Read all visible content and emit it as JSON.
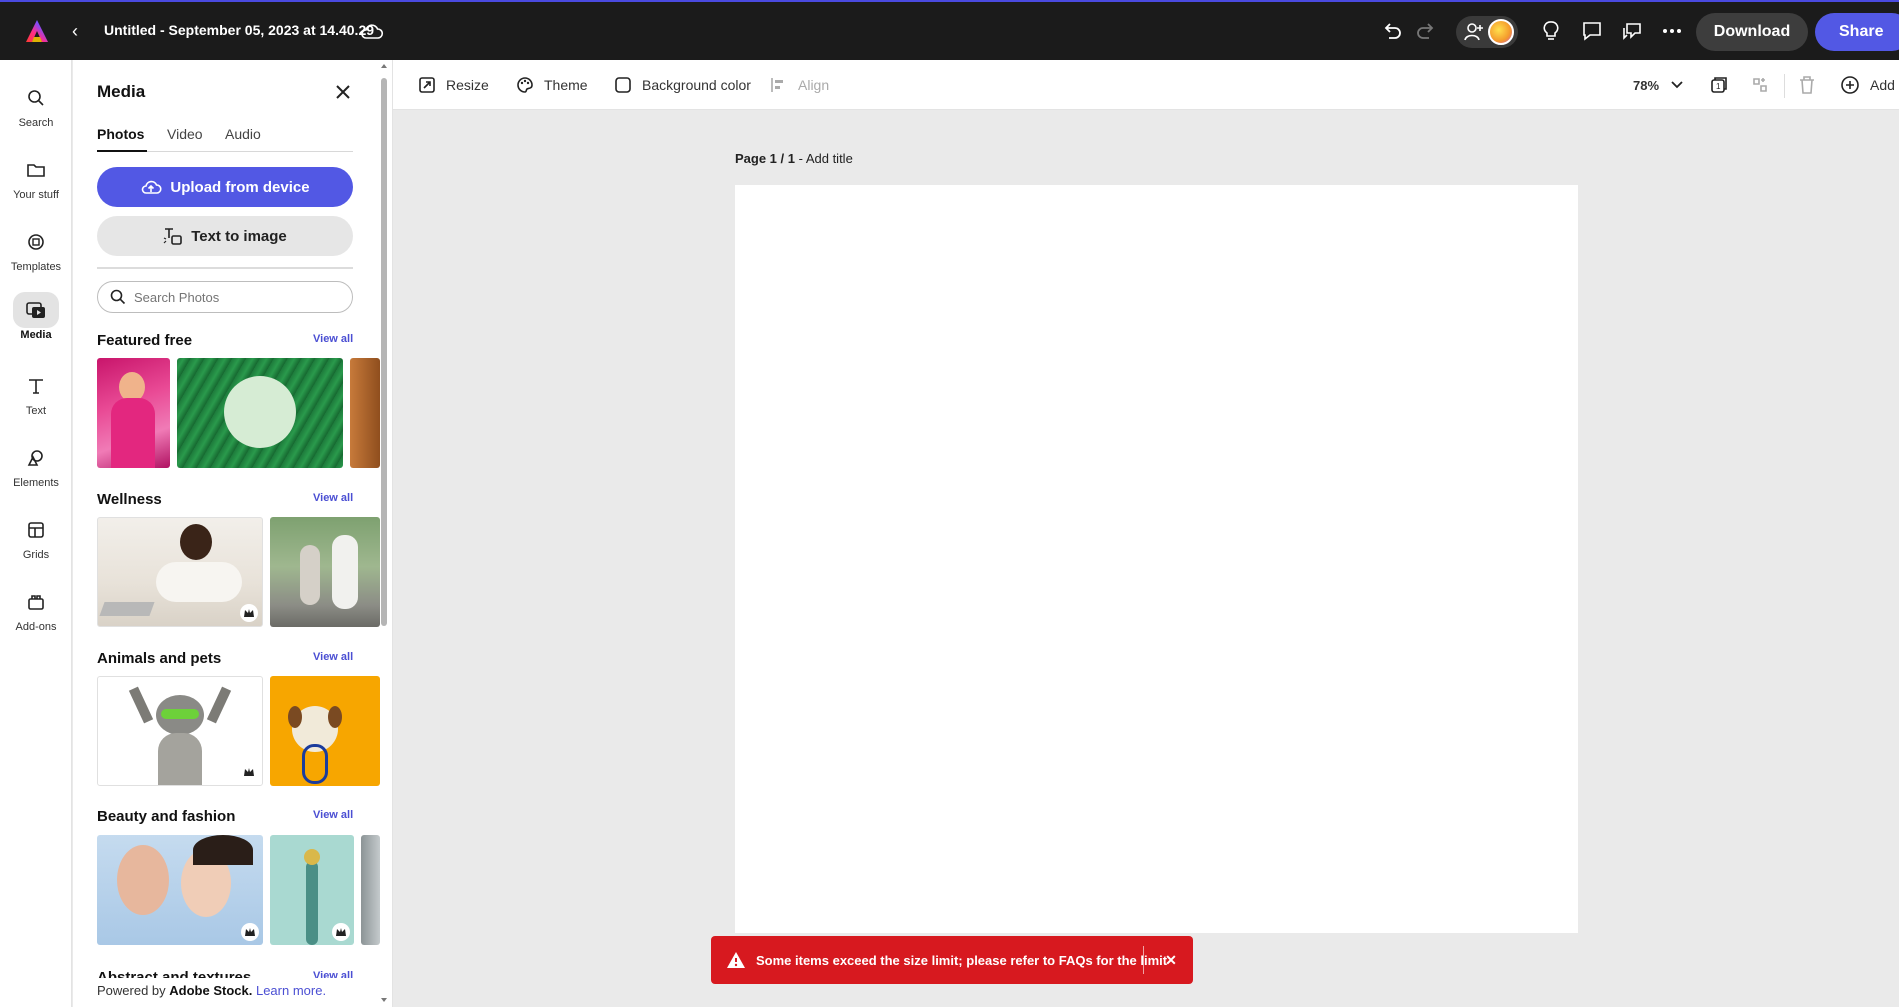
{
  "header": {
    "doc_title": "Untitled - September 05, 2023 at 14.40.29",
    "download_label": "Download",
    "share_label": "Share"
  },
  "rail": {
    "items": [
      {
        "label": "Search",
        "icon": "search-icon"
      },
      {
        "label": "Your stuff",
        "icon": "folder-icon"
      },
      {
        "label": "Templates",
        "icon": "templates-icon"
      },
      {
        "label": "Media",
        "icon": "media-icon",
        "active": true
      },
      {
        "label": "Text",
        "icon": "text-icon"
      },
      {
        "label": "Elements",
        "icon": "elements-icon"
      },
      {
        "label": "Grids",
        "icon": "grids-icon"
      },
      {
        "label": "Add-ons",
        "icon": "addons-icon"
      }
    ]
  },
  "panel": {
    "title": "Media",
    "tabs": [
      {
        "label": "Photos",
        "active": true
      },
      {
        "label": "Video"
      },
      {
        "label": "Audio"
      }
    ],
    "upload_label": "Upload from device",
    "text_to_image_label": "Text to image",
    "search_placeholder": "Search Photos",
    "view_all": "View all",
    "sections": [
      {
        "title": "Featured free"
      },
      {
        "title": "Wellness"
      },
      {
        "title": "Animals and pets"
      },
      {
        "title": "Beauty and fashion"
      },
      {
        "title": "Abstract and textures"
      }
    ],
    "powered_prefix": "Powered by ",
    "powered_brand": "Adobe Stock.",
    "powered_link": "Learn more."
  },
  "toolbar": {
    "resize": "Resize",
    "theme": "Theme",
    "background_color": "Background color",
    "align": "Align",
    "zoom": "78%",
    "add": "Add"
  },
  "canvas": {
    "page_label": "Page 1 / 1",
    "page_sep": " - ",
    "add_title": "Add title"
  },
  "toast": {
    "message": "Some items exceed the size limit; please refer to FAQs for the limit",
    "close": "✕"
  },
  "colors": {
    "accent": "#5258e4",
    "topbar_bg": "#1b1b1b",
    "toast_bg": "#d7191f",
    "link": "#4b4fd3"
  }
}
